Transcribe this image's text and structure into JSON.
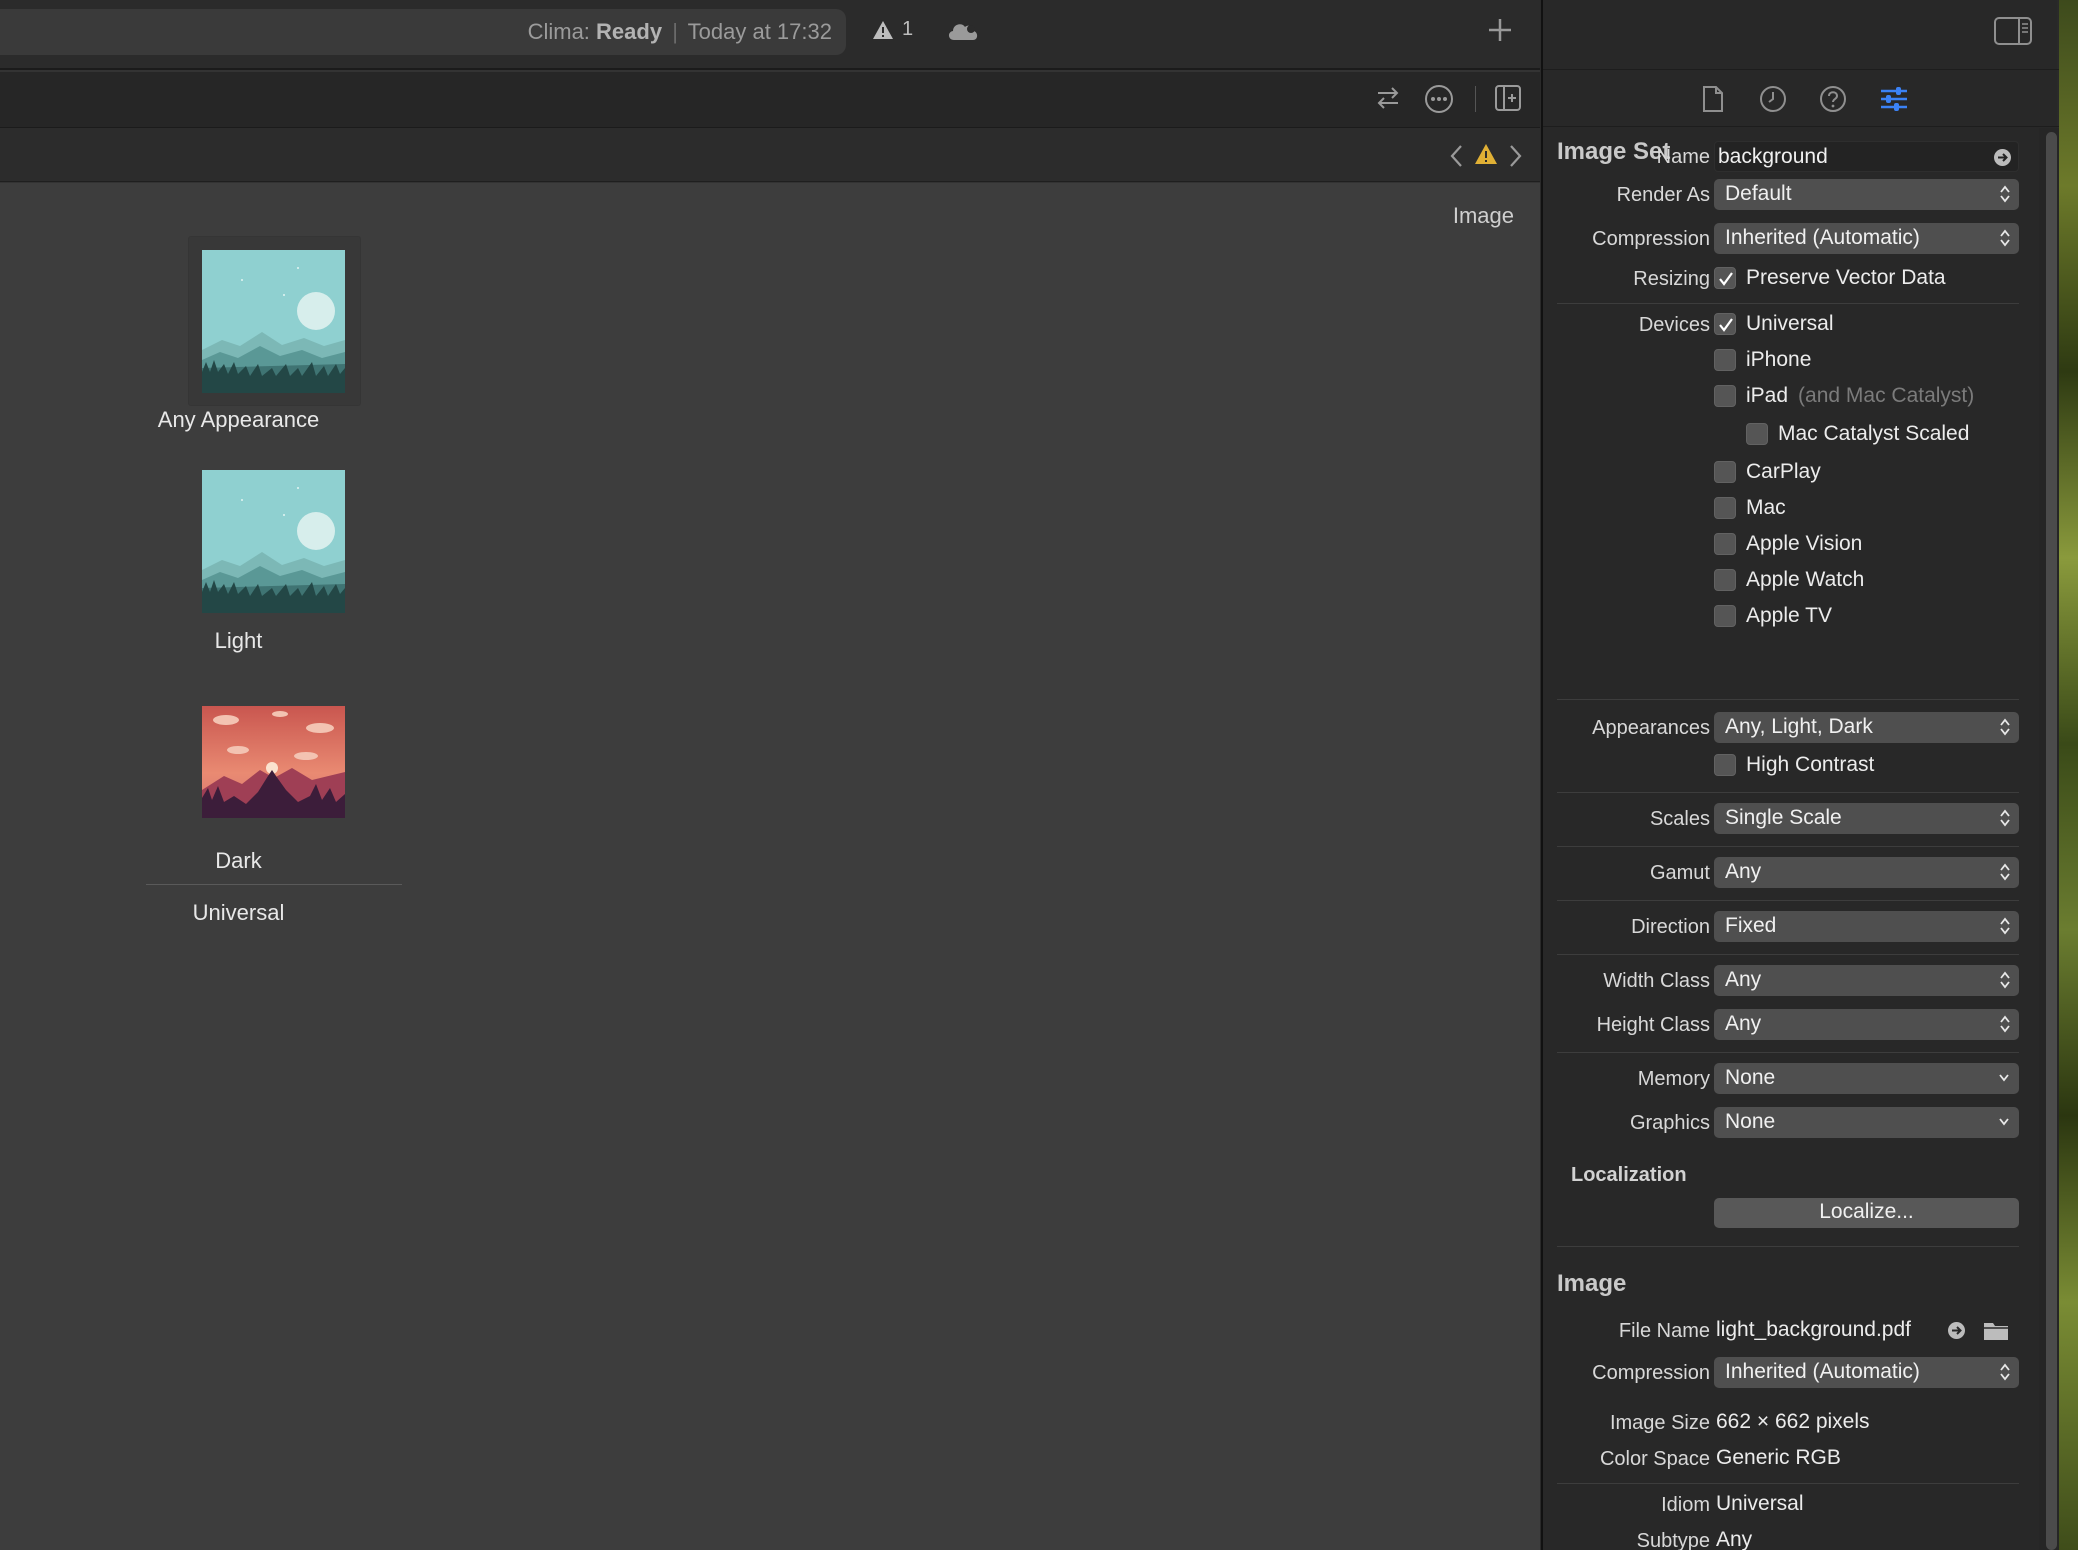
{
  "titlebar": {
    "project": "Clima:",
    "state": "Ready",
    "separator": "|",
    "time": "Today at 17:32",
    "warning_count": "1",
    "icons": [
      "warning-icon",
      "cloud-icon",
      "plus-icon"
    ]
  },
  "tabbar": {
    "icons": [
      "swap-arrows-icon",
      "more-options-icon",
      "add-editor-icon"
    ]
  },
  "jumpbar": {
    "icons": [
      "chevron-left-icon",
      "warning-icon",
      "chevron-right-icon"
    ]
  },
  "canvas": {
    "label": "Image",
    "slots": [
      {
        "label": "Any Appearance",
        "thumbnail": "light-landscape"
      },
      {
        "label": "Light",
        "thumbnail": "light-landscape"
      },
      {
        "label": "Dark",
        "thumbnail": "dark-landscape"
      }
    ],
    "group_label": "Universal"
  },
  "inspector": {
    "tabs": [
      "file-icon",
      "history-icon",
      "help-icon",
      "attributes-icon"
    ],
    "active_tab": "attributes-icon",
    "image_set": {
      "title": "Image Set",
      "name_label": "Name",
      "name_value": "background",
      "render_as_label": "Render As",
      "render_as_value": "Default",
      "compression_label": "Compression",
      "compression_value": "Inherited (Automatic)",
      "resizing_label": "Resizing",
      "preserve_vector_label": "Preserve Vector Data",
      "preserve_vector_checked": true,
      "devices_label": "Devices",
      "devices": [
        {
          "label": "Universal",
          "checked": true
        },
        {
          "label": "iPhone",
          "checked": false
        },
        {
          "label": "iPad",
          "note": "(and Mac Catalyst)",
          "checked": false
        },
        {
          "label": "Mac Catalyst Scaled",
          "checked": false
        },
        {
          "label": "CarPlay",
          "checked": false
        },
        {
          "label": "Mac",
          "checked": false
        },
        {
          "label": "Apple Vision",
          "checked": false
        },
        {
          "label": "Apple Watch",
          "checked": false
        },
        {
          "label": "Apple TV",
          "checked": false
        }
      ],
      "appearances_label": "Appearances",
      "appearances_value": "Any, Light, Dark",
      "high_contrast_label": "High Contrast",
      "high_contrast_checked": false,
      "scales_label": "Scales",
      "scales_value": "Single Scale",
      "gamut_label": "Gamut",
      "gamut_value": "Any",
      "direction_label": "Direction",
      "direction_value": "Fixed",
      "width_class_label": "Width Class",
      "width_class_value": "Any",
      "height_class_label": "Height Class",
      "height_class_value": "Any",
      "memory_label": "Memory",
      "memory_value": "None",
      "graphics_label": "Graphics",
      "graphics_value": "None",
      "localization_title": "Localization",
      "localize_button": "Localize..."
    },
    "image": {
      "title": "Image",
      "file_name_label": "File Name",
      "file_name_value": "light_background.pdf",
      "compression_label": "Compression",
      "compression_value": "Inherited (Automatic)",
      "image_size_label": "Image Size",
      "image_size_value": "662 × 662 pixels",
      "color_space_label": "Color Space",
      "color_space_value": "Generic RGB",
      "idiom_label": "Idiom",
      "idiom_value": "Universal",
      "subtype_label": "Subtype",
      "subtype_value": "Any"
    }
  },
  "colors": {
    "accent": "#3b82f6",
    "warning": "#e0b035"
  }
}
